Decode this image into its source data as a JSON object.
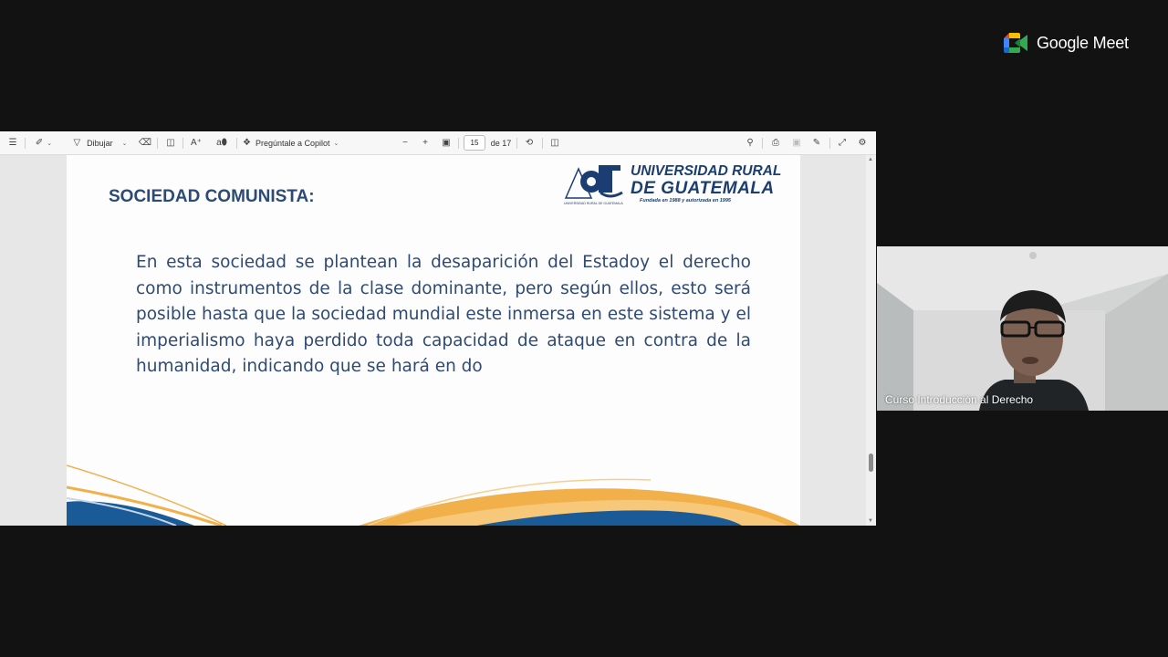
{
  "toolbar": {
    "draw_label": "Dibujar",
    "copilot_label": "Pregúntale a Copilot",
    "page_current": "15",
    "page_total_label": "de 17"
  },
  "slide": {
    "title": "SOCIEDAD COMUNISTA:",
    "body": "En esta sociedad se plantean la desaparición del Estadoy el derecho como instrumentos de la clase dominante, pero según ellos, esto será posible hasta que la sociedad mundial este inmersa en este sistema y el imperialismo haya perdido toda capacidad de ataque en contra de la humanidad, indicando que se hará en do",
    "logo": {
      "line1": "UNIVERSIDAD RURAL",
      "line2": "DE GUATEMALA",
      "tagline": "Fundada en 1988 y autorizada en 1995",
      "small_text": "UNIVERSIDAD RURAL DE GUATEMALA"
    }
  },
  "meet": {
    "brand": "Google Meet",
    "participant_name": "Curso Introducción al Derecho"
  },
  "icons": [
    "list-icon",
    "highlight-icon",
    "draw-icon",
    "eraser-icon",
    "text-box-icon",
    "read-aloud-icon",
    "translate-icon",
    "copilot-icon",
    "zoom-out-icon",
    "zoom-in-icon",
    "fit-page-icon",
    "rotate-icon",
    "page-view-icon",
    "search-icon",
    "print-icon",
    "save-icon",
    "annotate-icon",
    "fullscreen-icon",
    "settings-icon"
  ],
  "colors": {
    "title": "#2b4a75",
    "body_text": "#2f4a73",
    "logo_blue": "#1b3d72",
    "wave_orange": "#f2b04a",
    "wave_blue": "#1a5a97"
  }
}
